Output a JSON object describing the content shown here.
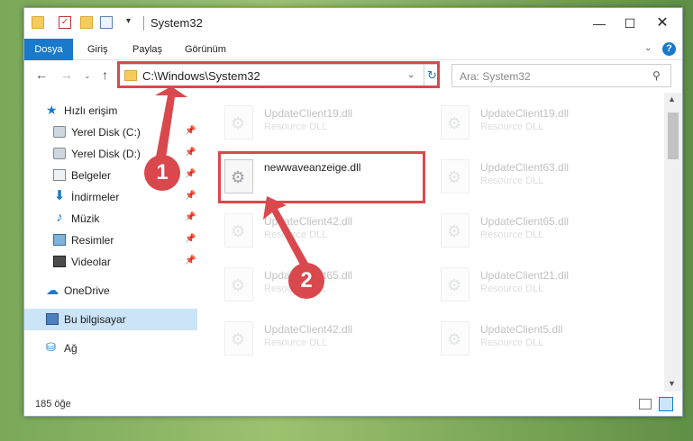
{
  "window": {
    "title": "System32",
    "min_glyph": "—",
    "max_glyph": "☐",
    "close_glyph": "✕"
  },
  "quick_access_toolbar": {
    "check_glyph": "✓",
    "dropdown_glyph": "▾"
  },
  "ribbon": {
    "tabs": [
      "Dosya",
      "Giriş",
      "Paylaş",
      "Görünüm"
    ],
    "collapse_glyph": "⌄",
    "help_glyph": "?"
  },
  "navigation": {
    "back_glyph": "←",
    "forward_glyph": "→",
    "recent_glyph": "⌄",
    "up_glyph": "↑",
    "address": "C:\\Windows\\System32",
    "address_dropdown_glyph": "⌄",
    "refresh_glyph": "↻",
    "search_placeholder": "Ara: System32",
    "search_glyph": "⚲"
  },
  "sidebar": {
    "items": [
      {
        "label": "Hızlı erişim",
        "icon": "star-icon",
        "glyph": "★"
      },
      {
        "label": "Yerel Disk (C:)",
        "icon": "drive-icon",
        "pinned": true
      },
      {
        "label": "Yerel Disk (D:)",
        "icon": "drive-icon",
        "pinned": true
      },
      {
        "label": "Belgeler",
        "icon": "documents-icon",
        "pinned": true
      },
      {
        "label": "İndirmeler",
        "icon": "download-icon",
        "glyph": "⬇",
        "pinned": true
      },
      {
        "label": "Müzik",
        "icon": "music-icon",
        "glyph": "♪",
        "pinned": true
      },
      {
        "label": "Resimler",
        "icon": "pictures-icon",
        "pinned": true
      },
      {
        "label": "Videolar",
        "icon": "video-icon",
        "pinned": true
      },
      {
        "label": "OneDrive",
        "icon": "cloud-icon",
        "glyph": "☁"
      },
      {
        "label": "Bu bilgisayar",
        "icon": "computer-icon",
        "selected": true
      },
      {
        "label": "Ağ",
        "icon": "network-icon",
        "glyph": "⛁"
      }
    ],
    "pin_glyph": "📌"
  },
  "files": [
    {
      "name": "UpdateClient19.dll",
      "type": "Resource DLL",
      "faded": true
    },
    {
      "name": "UpdateClient19.dll",
      "type": "Resource DLL",
      "faded": true
    },
    {
      "name": "newwaveanzeige.dll",
      "type": "",
      "faded": false
    },
    {
      "name": "UpdateClient63.dll",
      "type": "Resource DLL",
      "faded": true
    },
    {
      "name": "UpdateClient42.dll",
      "type": "Resource DLL",
      "faded": true
    },
    {
      "name": "UpdateClient65.dll",
      "type": "Resource DLL",
      "faded": true
    },
    {
      "name": "UpdateClient65.dll",
      "type": "Resource DLL",
      "faded": true
    },
    {
      "name": "UpdateClient21.dll",
      "type": "Resource DLL",
      "faded": true
    },
    {
      "name": "UpdateClient42.dll",
      "type": "Resource DLL",
      "faded": true
    },
    {
      "name": "UpdateClient5.dll",
      "type": "Resource DLL",
      "faded": true
    }
  ],
  "file_icon_glyph": "⚙",
  "scrollbar": {
    "up_glyph": "▲",
    "down_glyph": "▼"
  },
  "status": {
    "item_count": "185 öğe"
  },
  "annotations": {
    "step1": "1",
    "step2": "2",
    "color": "#d9484d"
  }
}
